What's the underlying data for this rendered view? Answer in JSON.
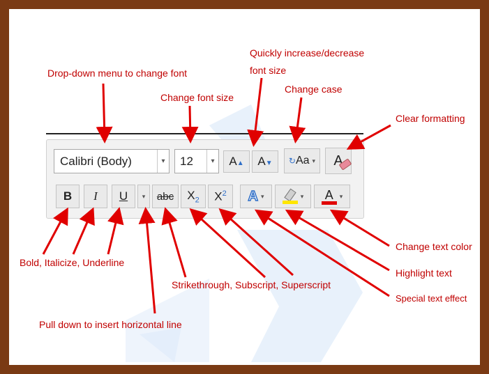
{
  "toolbar": {
    "font_name": "Calibri (Body)",
    "font_size": "12",
    "grow_font_glyph": "A",
    "shrink_font_glyph": "A",
    "change_case_glyph": "Aa",
    "clear_format_glyph": "A",
    "bold_glyph": "B",
    "italic_glyph": "I",
    "underline_glyph": "U",
    "strike_glyph": "abc",
    "subscript_glyph": "X",
    "subscript_digit": "2",
    "superscript_glyph": "X",
    "superscript_digit": "2",
    "text_effect_glyph": "A",
    "font_color_glyph": "A",
    "dropdown_arrow": "▾"
  },
  "labels": {
    "font_menu": "Drop-down menu to change font",
    "font_size": "Change font size",
    "grow_shrink_line1": "Quickly increase/decrease",
    "grow_shrink_line2": "font size",
    "change_case": "Change case",
    "clear_formatting": "Clear formatting",
    "bold_italic_underline": "Bold, Italicize, Underline",
    "strike_sub_super": "Strikethrough, Subscript, Superscript",
    "pull_down": "Pull down to insert horizontal line",
    "text_color": "Change text color",
    "highlight": "Highlight text",
    "text_effect": "Special text effect"
  },
  "colors": {
    "frame": "#7a3a14",
    "annotation": "#c00000",
    "highlight_bar": "#ffe600",
    "font_color_bar": "#e00000",
    "icon_blue": "#2f6fc8"
  }
}
